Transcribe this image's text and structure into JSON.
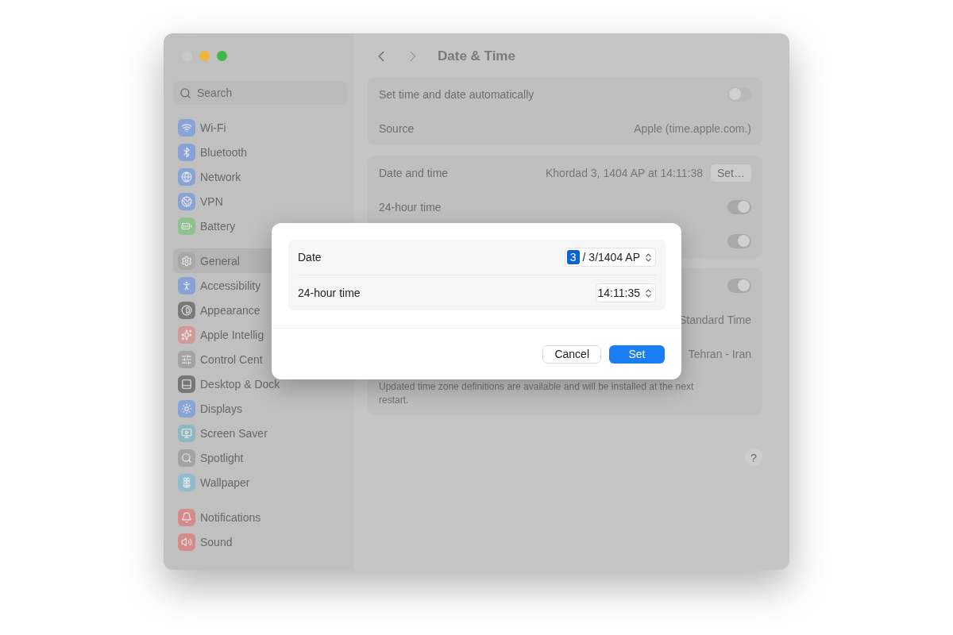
{
  "window": {
    "controls": [
      {
        "color": "#c9c9c9"
      },
      {
        "color": "#f0b53a"
      },
      {
        "color": "#3cb94a"
      }
    ]
  },
  "sidebar": {
    "search": {
      "placeholder": "Search"
    },
    "groups": [
      [
        {
          "label": "Wi-Fi",
          "color": "#8aa3d6",
          "selected": false
        },
        {
          "label": "Bluetooth",
          "color": "#8aa3d6",
          "selected": false
        },
        {
          "label": "Network",
          "color": "#8aa3d6",
          "selected": false
        },
        {
          "label": "VPN",
          "color": "#8aa3d6",
          "selected": false
        },
        {
          "label": "Battery",
          "color": "#8fc08f",
          "selected": false
        }
      ],
      [
        {
          "label": "General",
          "color": "#a8a8a8",
          "selected": true
        },
        {
          "label": "Accessibility",
          "color": "#8aa3d6",
          "selected": false
        },
        {
          "label": "Appearance",
          "color": "#7a7a7a",
          "selected": false
        },
        {
          "label": "Apple Intellig",
          "color": "#d19a9a",
          "selected": false
        },
        {
          "label": "Control Cent",
          "color": "#a3a3a3",
          "selected": false
        },
        {
          "label": "Desktop & Dock",
          "color": "#777777",
          "selected": false
        },
        {
          "label": "Displays",
          "color": "#8aa3d6",
          "selected": false
        },
        {
          "label": "Screen Saver",
          "color": "#8fb7c2",
          "selected": false
        },
        {
          "label": "Spotlight",
          "color": "#a3a3a3",
          "selected": false
        },
        {
          "label": "Wallpaper",
          "color": "#90bcd0",
          "selected": false
        }
      ],
      [
        {
          "label": "Notifications",
          "color": "#d78a8a",
          "selected": false
        },
        {
          "label": "Sound",
          "color": "#d78a8a",
          "selected": false
        }
      ]
    ]
  },
  "header": {
    "title": "Date & Time",
    "back_disabled": false,
    "forward_disabled": true
  },
  "groups": [
    [
      {
        "kind": "toggle",
        "label": "Set time and date automatically",
        "on": false
      },
      {
        "kind": "value",
        "label": "Source",
        "value": "Apple (time.apple.com.)"
      }
    ],
    [
      {
        "kind": "button",
        "label": "Date and time",
        "value": "Khordad 3, 1404 AP at 14:11:38",
        "button": "Set…"
      },
      {
        "kind": "toggle",
        "label": "24-hour time",
        "on": true
      },
      {
        "kind": "toggle",
        "on": true
      }
    ],
    [
      {
        "kind": "toggle",
        "on": true
      },
      {
        "kind": "value",
        "value": "Standard Time"
      },
      {
        "kind": "value",
        "value": "Tehran - Iran"
      },
      {
        "kind": "note",
        "text": "Updated time zone definitions are available and will be installed at the next restart."
      }
    ]
  ],
  "help": "?",
  "dialog": {
    "rows": [
      {
        "label": "Date",
        "segments": [
          {
            "text": "3",
            "selected": true
          },
          {
            "text": "/ 3/1404 AP",
            "selected": false
          }
        ]
      },
      {
        "label": "24-hour time",
        "segments": [
          {
            "text": "14:11:35",
            "selected": false
          }
        ]
      }
    ],
    "buttons": [
      {
        "label": "Cancel",
        "primary": false
      },
      {
        "label": "Set",
        "primary": true
      }
    ]
  }
}
